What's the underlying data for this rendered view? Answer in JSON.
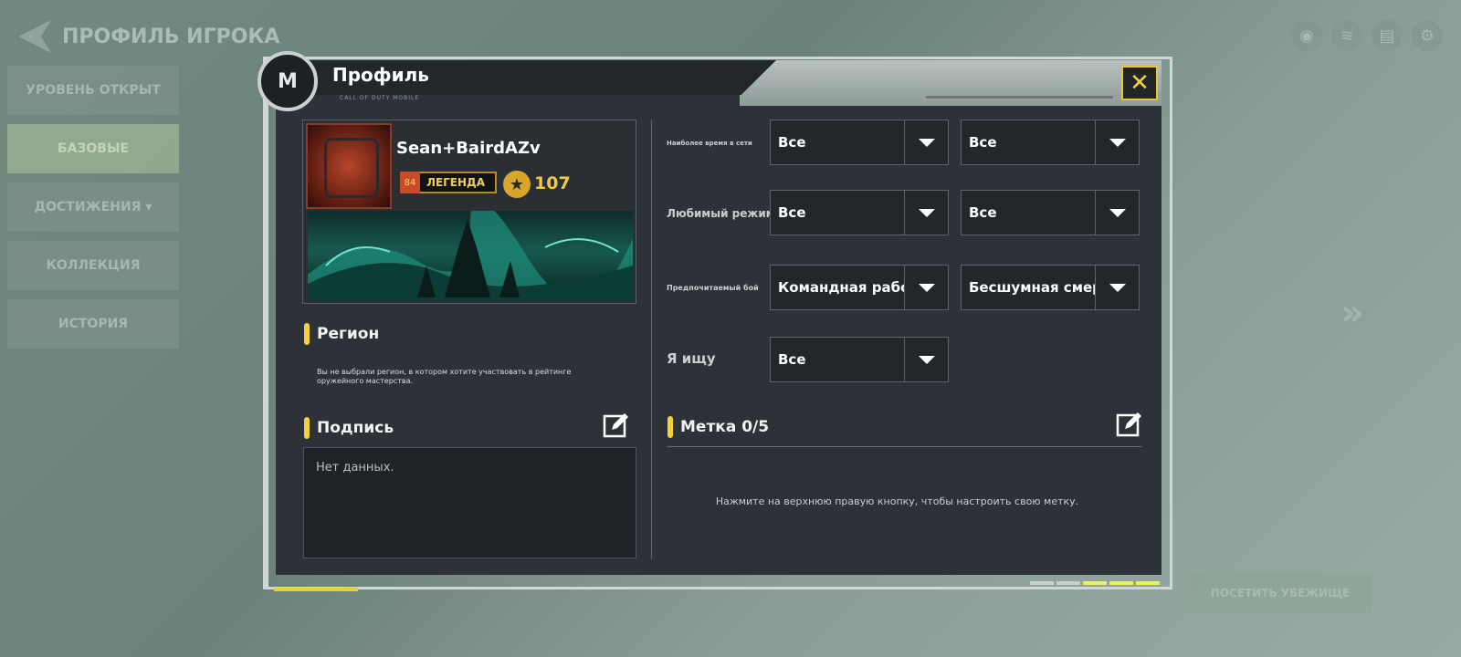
{
  "background": {
    "title": "ПРОФИЛЬ ИГРОКА",
    "nav": [
      "УРОВЕНЬ ОТКРЫТ",
      "БАЗОВЫЕ",
      "ДОСТИЖЕНИЯ ▾",
      "КОЛЛЕКЦИЯ",
      "ИСТОРИЯ"
    ],
    "button": "ПОСЕТИТЬ УБЕЖИЩЕ"
  },
  "dialog": {
    "title": "Профиль",
    "subtitle": "CALL OF DUTY MOBILE",
    "close_icon": "close-icon",
    "accent_color": "#f4d03b"
  },
  "player": {
    "name": "Sean+BairdAZv",
    "rank": "ЛЕГЕНДА",
    "rank_icon_text": "84",
    "level": "107"
  },
  "region": {
    "title": "Регион",
    "description": "Вы не выбрали регион, в котором хотите участвовать в рейтинге оружейного мастерства."
  },
  "signature": {
    "title": "Подпись",
    "text": "Нет данных."
  },
  "preferences": {
    "rows": [
      {
        "label": "Наиболее время в сети",
        "left": "Все",
        "right": "Все"
      },
      {
        "label": "Любимый режим",
        "left": "Все",
        "right": "Все"
      },
      {
        "label": "Предпочитаемый бой",
        "left": "Командная работа",
        "right": "Бесшумная смерть"
      },
      {
        "label": "Я ищу",
        "left": "Все"
      }
    ]
  },
  "tags": {
    "title": "Метка 0/5",
    "hint": "Нажмите на верхнюю правую кнопку, чтобы настроить свою метку."
  }
}
